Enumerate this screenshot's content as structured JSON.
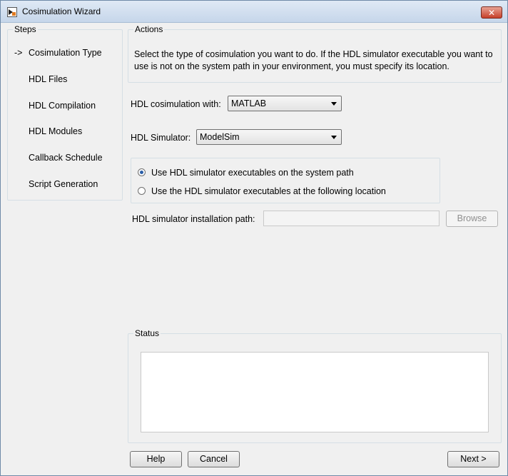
{
  "window": {
    "title": "Cosimulation Wizard",
    "close_label": "✕"
  },
  "steps": {
    "label": "Steps",
    "current_marker": "->",
    "items": [
      {
        "label": "Cosimulation Type"
      },
      {
        "label": "HDL Files"
      },
      {
        "label": "HDL Compilation"
      },
      {
        "label": "HDL Modules"
      },
      {
        "label": "Callback Schedule"
      },
      {
        "label": "Script Generation"
      }
    ]
  },
  "actions": {
    "label": "Actions",
    "description": "Select the type of cosimulation you want to do. If the HDL simulator executable you want to use is not on the system path in your environment, you must specify its location."
  },
  "form": {
    "cosim_label": "HDL cosimulation with:",
    "cosim_value": "MATLAB",
    "simulator_label": "HDL Simulator:",
    "simulator_value": "ModelSim",
    "radio_system_path": "Use HDL simulator executables on the system path",
    "radio_location": "Use the HDL simulator executables at the following location",
    "install_path_label": "HDL simulator installation path:",
    "install_path_value": "",
    "browse_label": "Browse"
  },
  "status": {
    "label": "Status",
    "text": ""
  },
  "footer": {
    "help_label": "Help",
    "cancel_label": "Cancel",
    "next_label": "Next >"
  }
}
